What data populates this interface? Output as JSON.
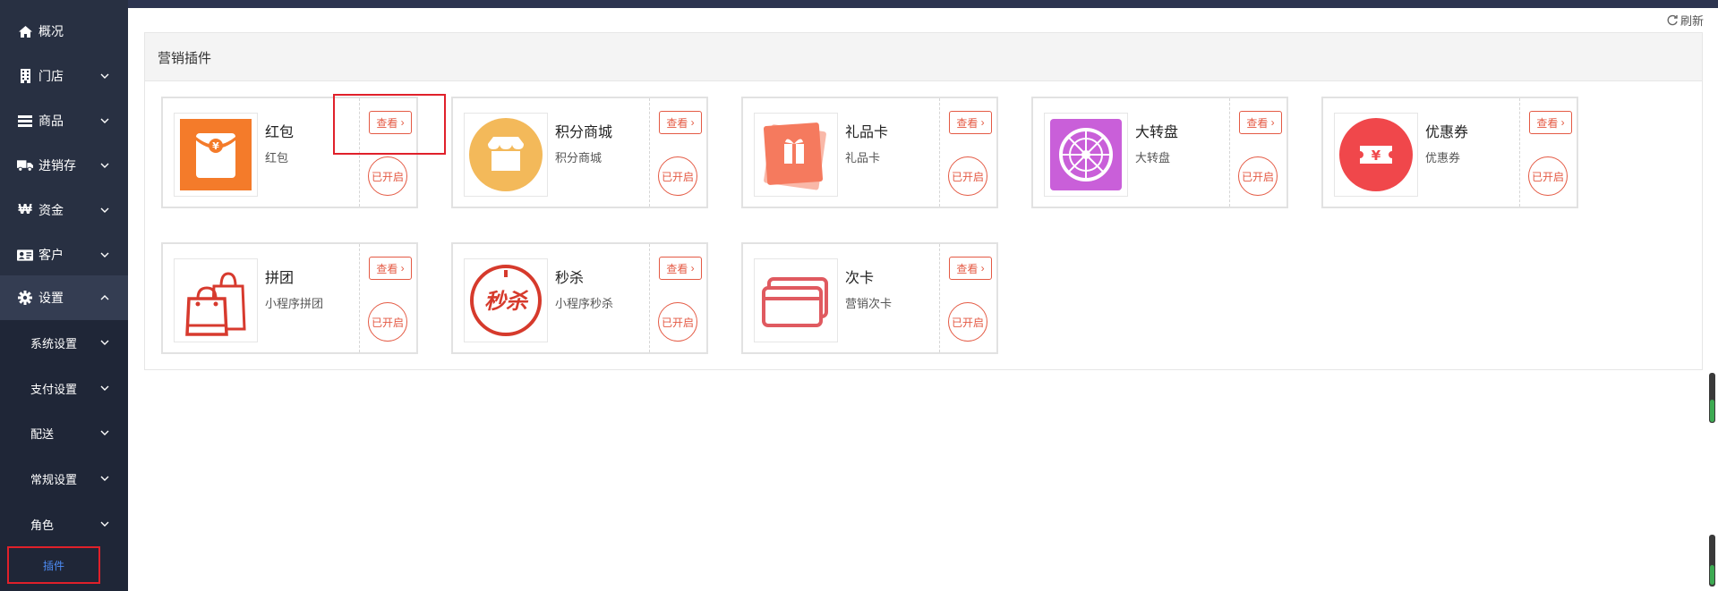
{
  "sidebar": {
    "items": [
      {
        "label": "概况",
        "icon": "home-icon"
      },
      {
        "label": "门店",
        "icon": "building-icon"
      },
      {
        "label": "商品",
        "icon": "list-icon"
      },
      {
        "label": "进销存",
        "icon": "truck-icon"
      },
      {
        "label": "资金",
        "icon": "won-icon"
      },
      {
        "label": "客户",
        "icon": "id-card-icon"
      },
      {
        "label": "设置",
        "icon": "gear-icon"
      }
    ],
    "sub_items": [
      {
        "label": "系统设置"
      },
      {
        "label": "支付设置"
      },
      {
        "label": "配送"
      },
      {
        "label": "常规设置"
      },
      {
        "label": "角色"
      }
    ],
    "active_plugin": "插件"
  },
  "toolbar": {
    "refresh_label": "刷新"
  },
  "panel": {
    "title": "营销插件"
  },
  "cards": [
    {
      "name": "红包",
      "desc": "红包",
      "view": "查看",
      "status": "已开启",
      "icon": "red-envelope-icon",
      "color": "#f47b2a"
    },
    {
      "name": "积分商城",
      "desc": "积分商城",
      "view": "查看",
      "status": "已开启",
      "icon": "store-icon",
      "color": "#f3b95a"
    },
    {
      "name": "礼品卡",
      "desc": "礼品卡",
      "view": "查看",
      "status": "已开启",
      "icon": "gift-card-icon",
      "color": "#f57a5e"
    },
    {
      "name": "大转盘",
      "desc": "大转盘",
      "view": "查看",
      "status": "已开启",
      "icon": "wheel-icon",
      "color": "#c95fd9"
    },
    {
      "name": "优惠券",
      "desc": "优惠券",
      "view": "查看",
      "status": "已开启",
      "icon": "coupon-icon",
      "color": "#f0474b"
    },
    {
      "name": "拼团",
      "desc": "小程序拼团",
      "view": "查看",
      "status": "已开启",
      "icon": "shopping-bag-icon",
      "color": "#d73a2e"
    },
    {
      "name": "秒杀",
      "desc": "小程序秒杀",
      "view": "查看",
      "status": "已开启",
      "icon": "flash-sale-icon",
      "color": "#d63a2c",
      "icon_text": "秒杀"
    },
    {
      "name": "次卡",
      "desc": "营销次卡",
      "view": "查看",
      "status": "已开启",
      "icon": "card-icon",
      "color": "#e05a60"
    }
  ],
  "colors": {
    "accent": "#e45a44",
    "sidebar_bg": "#283042",
    "highlight": "#e0202a",
    "active_link": "#4d8cf5"
  }
}
